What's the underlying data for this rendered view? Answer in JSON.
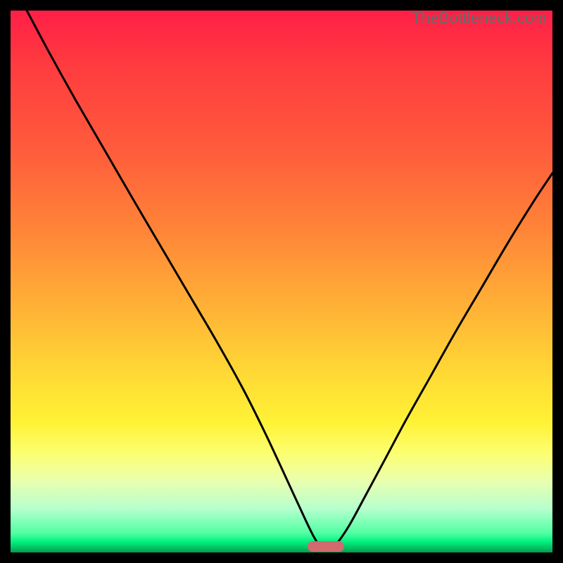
{
  "watermark": "TheBottleneck.com",
  "marker": {
    "cx_frac": 0.582,
    "y_frac": 0.989
  },
  "chart_data": {
    "type": "line",
    "title": "",
    "xlabel": "",
    "ylabel": "",
    "xlim": [
      0,
      1
    ],
    "ylim": [
      0,
      1
    ],
    "series": [
      {
        "name": "bottleneck-curve",
        "points_xy_frac": [
          [
            0.03,
            0.0
          ],
          [
            0.07,
            0.075
          ],
          [
            0.12,
            0.165
          ],
          [
            0.175,
            0.26
          ],
          [
            0.23,
            0.355
          ],
          [
            0.28,
            0.44
          ],
          [
            0.33,
            0.525
          ],
          [
            0.38,
            0.61
          ],
          [
            0.43,
            0.7
          ],
          [
            0.47,
            0.78
          ],
          [
            0.505,
            0.855
          ],
          [
            0.535,
            0.92
          ],
          [
            0.558,
            0.968
          ],
          [
            0.572,
            0.99
          ],
          [
            0.582,
            0.996
          ],
          [
            0.592,
            0.993
          ],
          [
            0.605,
            0.98
          ],
          [
            0.625,
            0.95
          ],
          [
            0.655,
            0.895
          ],
          [
            0.69,
            0.83
          ],
          [
            0.73,
            0.755
          ],
          [
            0.775,
            0.675
          ],
          [
            0.82,
            0.595
          ],
          [
            0.87,
            0.51
          ],
          [
            0.92,
            0.425
          ],
          [
            0.97,
            0.345
          ],
          [
            1.0,
            0.3
          ]
        ]
      }
    ],
    "background_gradient_stops": [
      {
        "pos": 0.0,
        "color": "#ff1f47"
      },
      {
        "pos": 0.1,
        "color": "#ff3b3f"
      },
      {
        "pos": 0.25,
        "color": "#ff5a3c"
      },
      {
        "pos": 0.4,
        "color": "#ff8338"
      },
      {
        "pos": 0.55,
        "color": "#ffb236"
      },
      {
        "pos": 0.67,
        "color": "#ffd935"
      },
      {
        "pos": 0.76,
        "color": "#fff235"
      },
      {
        "pos": 0.82,
        "color": "#fcff74"
      },
      {
        "pos": 0.87,
        "color": "#e8ffb0"
      },
      {
        "pos": 0.92,
        "color": "#b5ffce"
      },
      {
        "pos": 0.965,
        "color": "#4fffa2"
      },
      {
        "pos": 0.98,
        "color": "#00f27f"
      },
      {
        "pos": 1.0,
        "color": "#009f50"
      }
    ],
    "marker": {
      "x_frac": 0.582,
      "y_frac": 0.989,
      "color": "#d06a6e"
    }
  }
}
